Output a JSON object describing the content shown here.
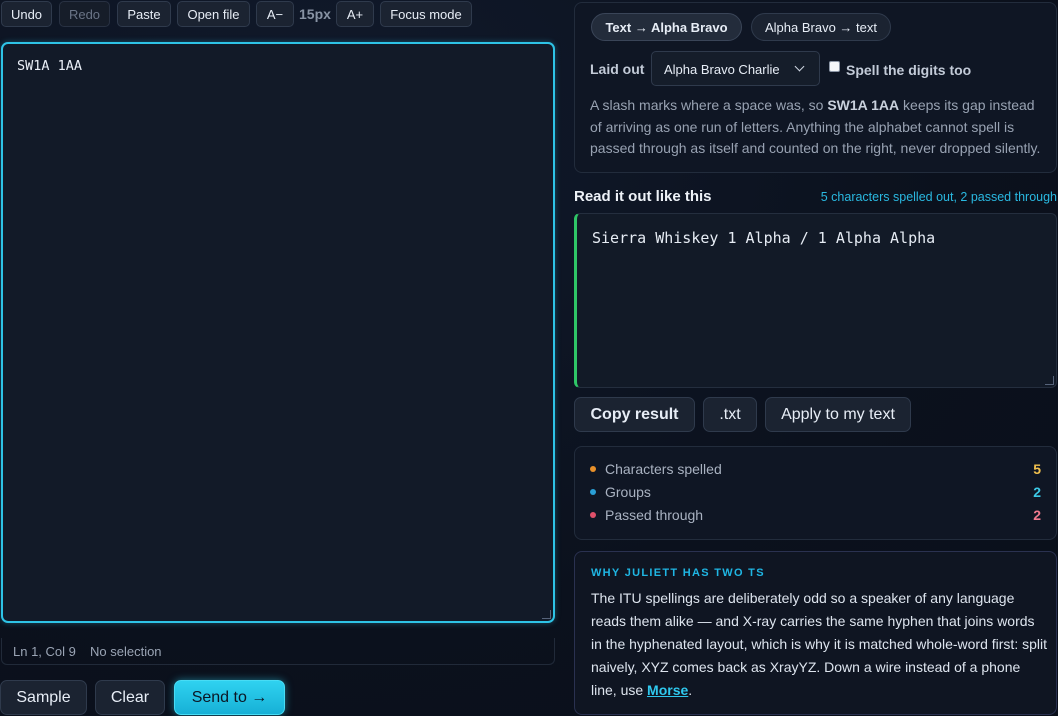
{
  "toolbar": {
    "undo": "Undo",
    "redo": "Redo",
    "paste": "Paste",
    "open_file": "Open file",
    "font_down": "A−",
    "font_size": "15px",
    "font_up": "A+",
    "focus_mode": "Focus mode"
  },
  "editor": {
    "value": "SW1A 1AA"
  },
  "status": {
    "position": "Ln 1, Col 9",
    "selection": "No selection"
  },
  "actions": {
    "sample": "Sample",
    "clear": "Clear",
    "send_to": "Send to →"
  },
  "mode": {
    "tabs": [
      "Text → Alpha Bravo",
      "Alpha Bravo → text"
    ],
    "active_tab": 0,
    "laid_out_label": "Laid out",
    "layout_selected": "Alpha Bravo Charlie",
    "spell_digits_label": "Spell the digits too",
    "spell_digits_checked": false,
    "description": {
      "before": "A slash marks where a space was, so ",
      "example": "SW1A 1AA",
      "after": " keeps its gap instead of arriving as one run of letters. Anything the alphabet cannot spell is passed through as itself and counted on the right, never dropped silently."
    }
  },
  "result": {
    "heading": "Read it out like this",
    "summary": "5 characters spelled out, 2 passed through",
    "text": "Sierra Whiskey 1 Alpha / 1 Alpha Alpha",
    "copy": "Copy result",
    "txt": ".txt",
    "apply": "Apply to my text"
  },
  "stats": [
    {
      "label": "Characters spelled",
      "value": "5",
      "color": "#e8902a",
      "value_color": "#f2c14e"
    },
    {
      "label": "Groups",
      "value": "2",
      "color": "#2a9fd6",
      "value_color": "#3cc9e6"
    },
    {
      "label": "Passed through",
      "value": "2",
      "color": "#e0506a",
      "value_color": "#f07a8e"
    }
  ],
  "why": {
    "heading": "WHY JULIETT HAS TWO TS",
    "body": "The ITU spellings are deliberately odd so a speaker of any language reads them alike — and X-ray carries the same hyphen that joins words in the hyphenated layout, which is why it is matched whole-word first: split naively, XYZ comes back as XrayYZ. Down a wire instead of a phone line, use ",
    "link": "Morse",
    "end": "."
  },
  "colors": {
    "accent": "#2ec3e6",
    "result_bar": "#2fc667",
    "background": "#0c1220"
  }
}
